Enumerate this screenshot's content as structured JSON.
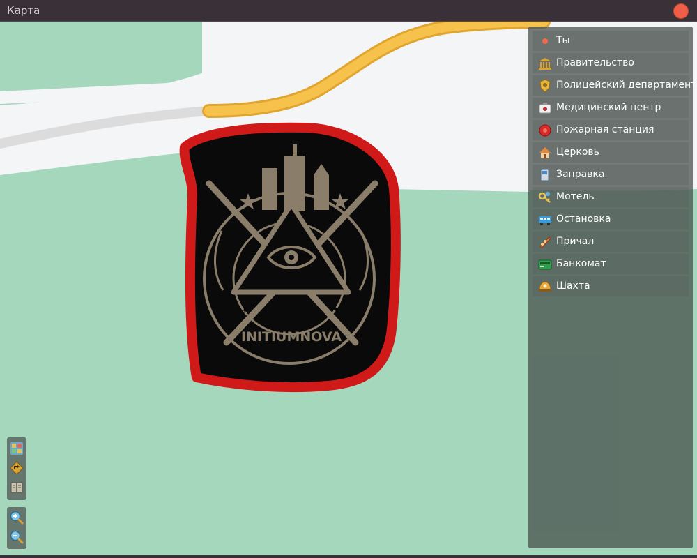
{
  "window": {
    "title": "Карта"
  },
  "map": {
    "emblem": {
      "text": "INITIUMNOVA",
      "colors": {
        "outline": "#d01a1a",
        "fill": "#0a0a0a",
        "ink": "#8a7d6a"
      }
    },
    "colors": {
      "land": "#a4d7bc",
      "area": "#f4f5f7",
      "road": "#dcdcdc",
      "highway": "#f6c24b",
      "highway_edge": "#e0a52e"
    }
  },
  "legend": {
    "items": [
      {
        "label": "Ты",
        "icon": "player-dot-icon"
      },
      {
        "label": "Правительство",
        "icon": "government-building-icon"
      },
      {
        "label": "Полицейский департамент",
        "icon": "police-badge-icon"
      },
      {
        "label": "Медицинский центр",
        "icon": "medical-kit-icon"
      },
      {
        "label": "Пожарная станция",
        "icon": "fire-bell-icon"
      },
      {
        "label": "Церковь",
        "icon": "church-icon"
      },
      {
        "label": "Заправка",
        "icon": "gas-pump-icon"
      },
      {
        "label": "Мотель",
        "icon": "motel-key-icon"
      },
      {
        "label": "Остановка",
        "icon": "bus-icon"
      },
      {
        "label": "Причал",
        "icon": "pier-boat-icon"
      },
      {
        "label": "Банкомат",
        "icon": "atm-card-icon"
      },
      {
        "label": "Шахта",
        "icon": "mine-helmet-icon"
      }
    ]
  },
  "tools": {
    "layers": "layers-icon",
    "directions": "directions-sign-icon",
    "book": "map-book-icon",
    "zoom_in": "zoom-in-icon",
    "zoom_out": "zoom-out-icon"
  }
}
